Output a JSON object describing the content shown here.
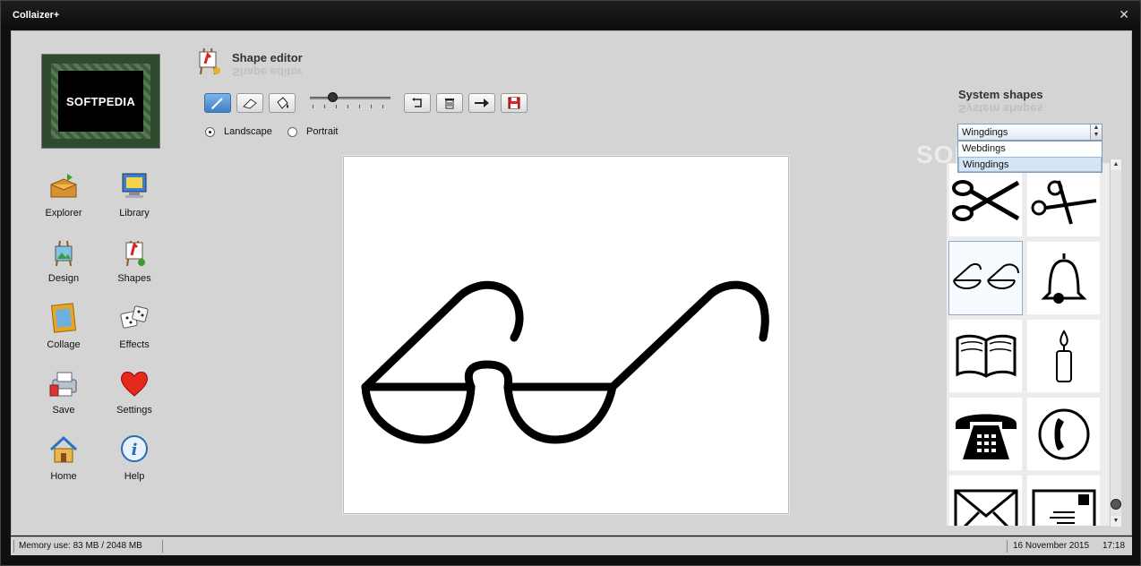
{
  "window": {
    "title": "Collaizer+",
    "close_glyph": "✕"
  },
  "logo": {
    "text": "SOFTPEDIA"
  },
  "nav": [
    {
      "label": "Explorer",
      "icon": "explorer-icon"
    },
    {
      "label": "Library",
      "icon": "library-icon"
    },
    {
      "label": "Design",
      "icon": "design-icon"
    },
    {
      "label": "Shapes",
      "icon": "shapes-icon"
    },
    {
      "label": "Collage",
      "icon": "collage-icon"
    },
    {
      "label": "Effects",
      "icon": "effects-icon"
    },
    {
      "label": "Save",
      "icon": "save-icon"
    },
    {
      "label": "Settings",
      "icon": "settings-icon"
    },
    {
      "label": "Home",
      "icon": "home-icon"
    },
    {
      "label": "Help",
      "icon": "help-icon"
    }
  ],
  "editor": {
    "title": "Shape editor",
    "tools": [
      "pen-tool",
      "eraser-tool",
      "fill-tool",
      "undo-tool",
      "delete-tool",
      "forward-tool",
      "save-tool"
    ],
    "brush_size_fraction": 0.25,
    "orientation": {
      "landscape_label": "Landscape",
      "portrait_label": "Portrait",
      "selected": "Landscape"
    }
  },
  "system_shapes": {
    "title": "System shapes",
    "selected_font": "Wingdings",
    "options": [
      "Webdings",
      "Wingdings"
    ],
    "highlighted_option": "Wingdings",
    "tiles": [
      "scissors-icon",
      "scissors-open-icon",
      "glasses-icon",
      "bell-icon",
      "open-book-icon",
      "candle-icon",
      "telephone-icon",
      "phone-circle-icon",
      "envelope-icon",
      "letter-icon"
    ],
    "selected_tile": "glasses-icon"
  },
  "watermark": "SOFTPEDIA",
  "status": {
    "memory": "Memory use: 83 MB / 2048 MB",
    "date": "16 November 2015",
    "time": "17:18"
  },
  "colors": {
    "active_tool": "#3f7fc6",
    "selection": "#d6e5f5"
  }
}
